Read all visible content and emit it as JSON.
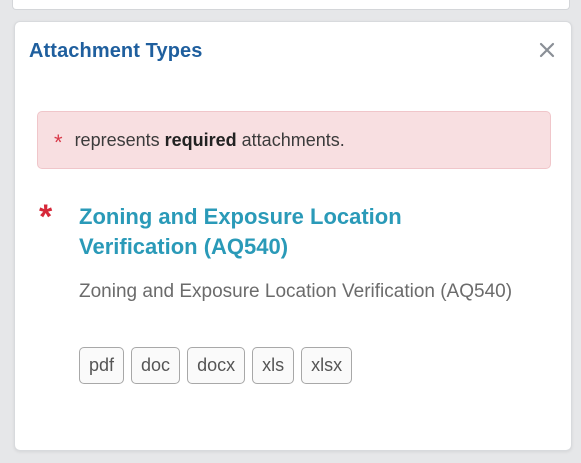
{
  "dialog": {
    "title": "Attachment Types",
    "close_label": "×"
  },
  "notice": {
    "star": "*",
    "prefix": "represents",
    "bold_word": "required",
    "suffix": "attachments."
  },
  "attachment": {
    "required_marker": "*",
    "title": "Zoning and Exposure Location Verification (AQ540)",
    "description": "Zoning and Exposure Location Verification (AQ540)",
    "extensions": [
      "pdf",
      "doc",
      "docx",
      "xls",
      "xlsx"
    ]
  },
  "colors": {
    "title_blue": "#1f5f9e",
    "link_teal": "#2a9ab8",
    "required_red": "#d62839",
    "notice_bg": "#f8dfe1"
  }
}
